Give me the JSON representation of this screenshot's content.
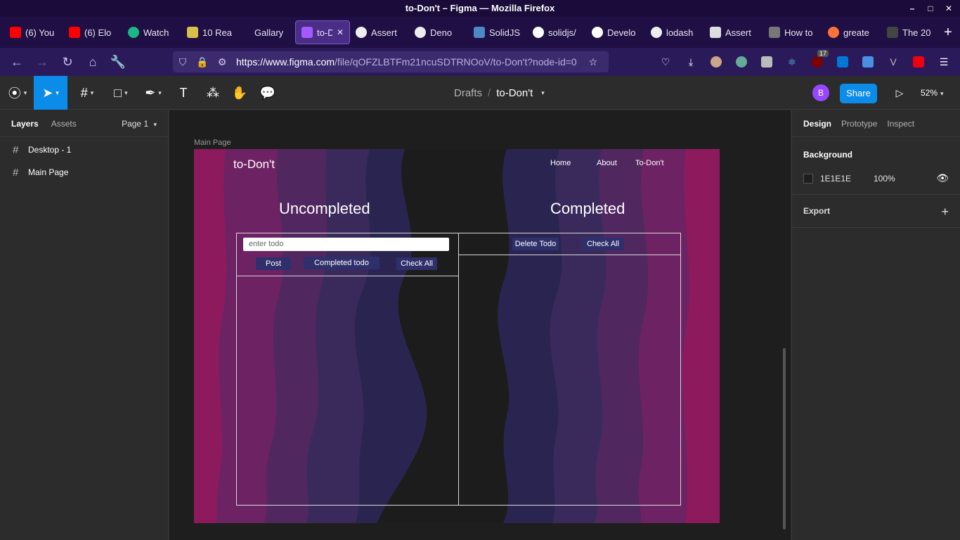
{
  "window": {
    "title": "to-Don't – Figma — Mozilla Firefox"
  },
  "tabs": [
    {
      "label": "(6) You",
      "icon": "youtube-icon",
      "color": "#ff0000"
    },
    {
      "label": "(6) Elo",
      "icon": "youtube-icon",
      "color": "#ff0000"
    },
    {
      "label": "Watch",
      "icon": "play-icon",
      "color": "#1db584"
    },
    {
      "label": "10 Rea",
      "icon": "book-icon",
      "color": "#d8c04a"
    },
    {
      "label": "Gallary",
      "icon": "",
      "color": ""
    },
    {
      "label": "to-D",
      "icon": "figma-icon",
      "color": "#a259ff",
      "active": true
    },
    {
      "label": "Assert",
      "icon": "deno-icon",
      "color": "#ffffff"
    },
    {
      "label": "Deno",
      "icon": "deno-icon",
      "color": "#ffffff"
    },
    {
      "label": "SolidJS",
      "icon": "solid-icon",
      "color": "#4f88c6"
    },
    {
      "label": "solidjs/",
      "icon": "github-icon",
      "color": "#ffffff"
    },
    {
      "label": "Develo",
      "icon": "vercel-icon",
      "color": "#ffffff"
    },
    {
      "label": "lodash",
      "icon": "deno-icon",
      "color": "#ffffff"
    },
    {
      "label": "Assert",
      "icon": "shield-icon",
      "color": "#ffffff"
    },
    {
      "label": "How to",
      "icon": "code-icon",
      "color": "#ffffff"
    },
    {
      "label": "greate",
      "icon": "firefox-icon",
      "color": "#ff7139"
    },
    {
      "label": "The 20",
      "icon": "site-icon",
      "color": "#ffffff"
    }
  ],
  "nav": {
    "url_host": "https://www.figma.com",
    "url_path": "/file/qOFZLBTFm21ncuSDTRNOoV/to-Don't?node-id=0",
    "ext_badge": "17"
  },
  "figma": {
    "breadcrumb_root": "Drafts",
    "breadcrumb_sep": "/",
    "file_name": "to-Don't",
    "avatar_initial": "B",
    "share_label": "Share",
    "zoom": "52%"
  },
  "left_panel": {
    "tab_layers": "Layers",
    "tab_assets": "Assets",
    "page": "Page 1",
    "layers": [
      "Desktop - 1",
      "Main Page"
    ]
  },
  "canvas": {
    "frame_label": "Main Page",
    "site": {
      "title": "to-Don't",
      "nav": [
        "Home",
        "About",
        "To-Don't"
      ],
      "uncompleted_heading": "Uncompleted",
      "completed_heading": "Completed",
      "input_placeholder": "enter todo",
      "btn_post": "Post",
      "btn_completed_todo": "Completed todo",
      "btn_check_all_left": "Check All",
      "btn_delete_todo": "Delete Todo",
      "btn_check_all_right": "Check All"
    },
    "help": "?"
  },
  "right_panel": {
    "tab_design": "Design",
    "tab_prototype": "Prototype",
    "tab_inspect": "Inspect",
    "background_label": "Background",
    "background_hex": "1E1E1E",
    "background_opacity": "100%",
    "export_label": "Export"
  },
  "colors": {
    "accent": "#0c8ce9",
    "frame_magenta": "#8e1a5e",
    "button_navy": "#2f2f6b"
  }
}
